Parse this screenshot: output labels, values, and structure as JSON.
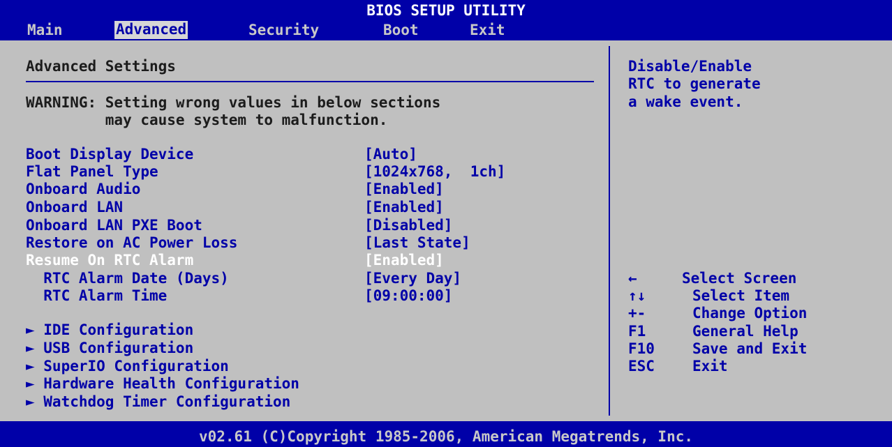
{
  "title": "BIOS SETUP UTILITY",
  "menu": [
    {
      "label": "Main",
      "active": false
    },
    {
      "label": "Advanced",
      "active": true
    },
    {
      "label": "Security",
      "active": false
    },
    {
      "label": "Boot",
      "active": false
    },
    {
      "label": "Exit",
      "active": false
    }
  ],
  "main": {
    "heading": "Advanced Settings",
    "warning_line1": "WARNING: Setting wrong values in below sections",
    "warning_line2": "         may cause system to malfunction.",
    "settings": [
      {
        "label": "Boot Display Device",
        "value": "[Auto]"
      },
      {
        "label": "Flat Panel Type",
        "value": "[1024x768,  1ch]"
      },
      {
        "label": "Onboard Audio",
        "value": "[Enabled]"
      },
      {
        "label": "Onboard LAN",
        "value": "[Enabled]"
      },
      {
        "label": "Onboard LAN PXE Boot",
        "value": "[Disabled]"
      },
      {
        "label": "Restore on AC Power Loss",
        "value": "[Last State]"
      },
      {
        "label": "Resume On RTC Alarm",
        "value": "[Enabled]",
        "selected": true
      },
      {
        "label": "  RTC Alarm Date (Days)",
        "value": "[Every Day]"
      },
      {
        "label": "  RTC Alarm Time",
        "value": "[09:00:00]"
      }
    ],
    "submenus": [
      "► IDE Configuration",
      "► USB Configuration",
      "► SuperIO Configuration",
      "► Hardware Health Configuration",
      "► Watchdog Timer Configuration"
    ]
  },
  "help": {
    "text_line1": "Disable/Enable",
    "text_line2": "RTC to generate",
    "text_line3": "a wake event.",
    "keys": [
      {
        "key": "←",
        "desc": "Select Screen"
      },
      {
        "key": "↑↓",
        "desc": "Select Item"
      },
      {
        "key": "+-",
        "desc": "Change Option"
      },
      {
        "key": "F1",
        "desc": "General Help"
      },
      {
        "key": "F10",
        "desc": "Save and Exit"
      },
      {
        "key": "ESC",
        "desc": "Exit"
      }
    ]
  },
  "footer": "v02.61 (C)Copyright 1985-2006, American Megatrends, Inc."
}
